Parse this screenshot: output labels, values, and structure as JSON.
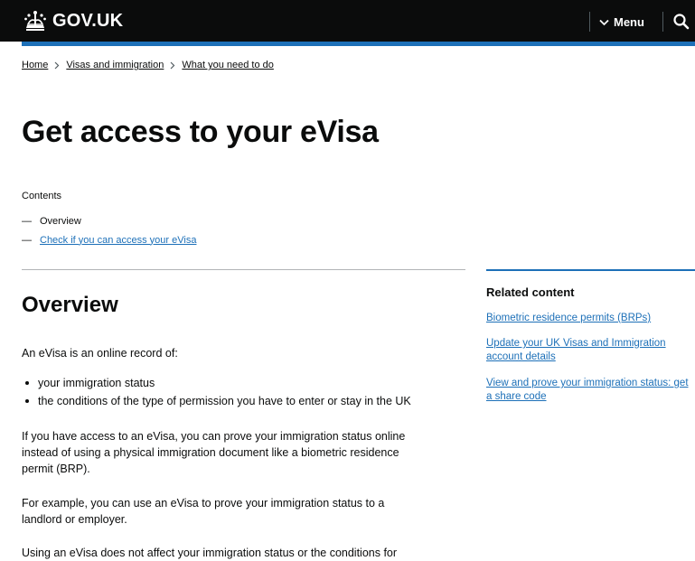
{
  "header": {
    "logo_text": "GOV.UK",
    "menu_label": "Menu",
    "colors": {
      "header_bg": "#0b0c0c",
      "accent": "#1d70b8"
    }
  },
  "breadcrumb": [
    {
      "label": "Home"
    },
    {
      "label": "Visas and immigration"
    },
    {
      "label": "What you need to do"
    }
  ],
  "page": {
    "title": "Get access to your eVisa",
    "contents": {
      "label": "Contents",
      "items": [
        {
          "label": "Overview",
          "current": true
        },
        {
          "label": "Check if you can access your eVisa",
          "current": false
        }
      ]
    }
  },
  "overview": {
    "heading": "Overview",
    "intro": "An eVisa is an online record of:",
    "bullets": [
      "your immigration status",
      "the conditions of the type of permission you have to enter or stay in the UK"
    ],
    "para1_line1": "If you have access to an eVisa, you can prove your immigration status online",
    "para1_line2": "instead of using a physical immigration document like a biometric residence",
    "para1_line3": "permit (BRP).",
    "para2_line1": "For example, you can use an eVisa to prove your immigration status to a",
    "para2_line2": "landlord or employer.",
    "para3_line1": "Using an eVisa does not affect your immigration status or the conditions for"
  },
  "related": {
    "title": "Related content",
    "links": [
      {
        "line1": "Biometric residence permits (BRPs)"
      },
      {
        "line1": "Update your UK Visas and Immigration",
        "line2": "account details"
      },
      {
        "line1": "View and prove your immigration status: get",
        "line2": "a share code"
      }
    ]
  }
}
